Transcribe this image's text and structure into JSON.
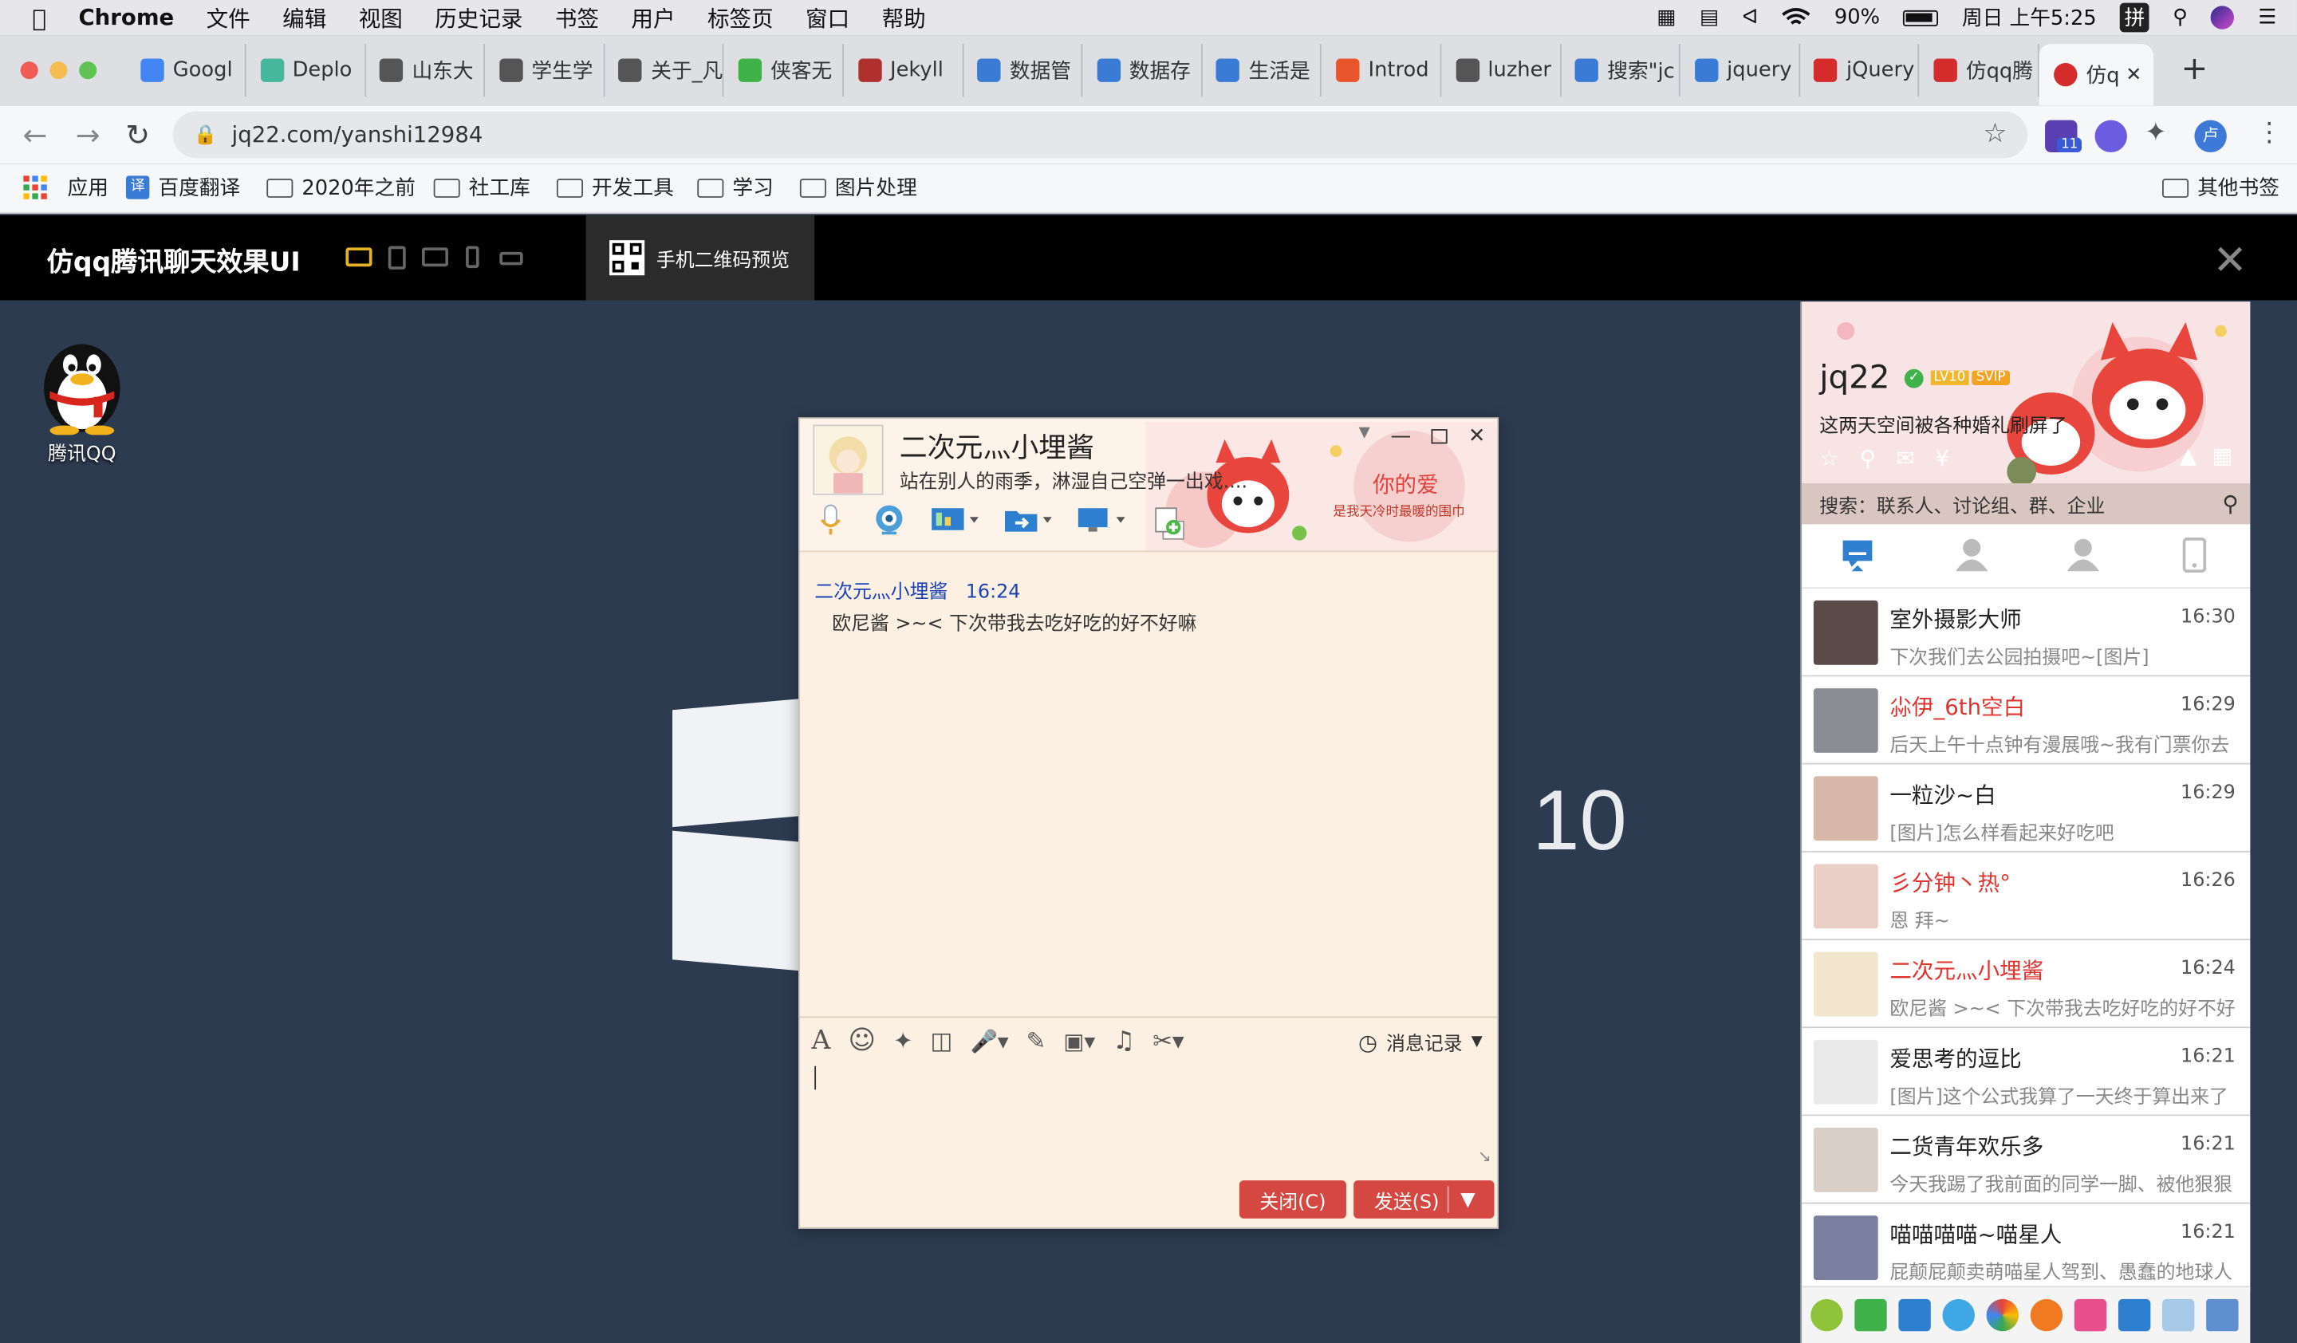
{
  "menubar": {
    "app": "Chrome",
    "items": [
      "文件",
      "编辑",
      "视图",
      "历史记录",
      "书签",
      "用户",
      "标签页",
      "窗口",
      "帮助"
    ],
    "battery": "90%",
    "clock": "周日 上午5:25",
    "ime": "拼"
  },
  "tabs": [
    {
      "label": "Googl",
      "color": "#4285f4"
    },
    {
      "label": "Deplo",
      "color": "#44b79c"
    },
    {
      "label": "山东大",
      "color": "#555"
    },
    {
      "label": "学生学",
      "color": "#555"
    },
    {
      "label": "关于_凡",
      "color": "#555"
    },
    {
      "label": "侠客无",
      "color": "#3fb24a"
    },
    {
      "label": "Jekyll",
      "color": "#b03030"
    },
    {
      "label": "数据管",
      "color": "#3a7bd5"
    },
    {
      "label": "数据存",
      "color": "#3a7bd5"
    },
    {
      "label": "生活是",
      "color": "#3a7bd5"
    },
    {
      "label": "Introd",
      "color": "#e8552a"
    },
    {
      "label": "luzher",
      "color": "#555"
    },
    {
      "label": "搜索\"jc",
      "color": "#3a7bd5"
    },
    {
      "label": "jquery",
      "color": "#3a7bd5"
    },
    {
      "label": "jQuery",
      "color": "#d42b2b"
    },
    {
      "label": "仿qq腾",
      "color": "#d42b2b"
    }
  ],
  "active_tab": {
    "label": "仿q",
    "close": "✕"
  },
  "address": {
    "url": "jq22.com/yanshi12984"
  },
  "extensions": {
    "badge": "11",
    "avatar": "卢"
  },
  "bookmarks": {
    "apps": "应用",
    "items": [
      "百度翻译",
      "2020年之前",
      "社工库",
      "开发工具",
      "学习",
      "图片处理"
    ],
    "other": "其他书签"
  },
  "page_header": {
    "title": "仿qq腾讯聊天效果UI",
    "qr_label": "手机二维码预览",
    "close": "✕"
  },
  "desktop": {
    "qq_label": "腾讯QQ",
    "win_text": "10"
  },
  "chat": {
    "name": "二次元灬小埋酱",
    "signature": "站在别人的雨季，淋湿自己空弹一出戏....",
    "banner_text": "你的爱",
    "banner_sub": "是我天冷时最暖的围巾",
    "message": {
      "sender": "二次元灬小埋酱",
      "time": "16:24",
      "text": "欧尼酱 >~< 下次带我去吃好吃的好不好嘛"
    },
    "history_label": "消息记录",
    "close_button": "关闭(C)",
    "send_button": "发送(S)"
  },
  "panel": {
    "username": "jq22",
    "level": "LV10",
    "svip": "SVIP",
    "signature": "这两天空间被各种婚礼刷屏了",
    "search_placeholder": "搜索：联系人、讨论组、群、企业",
    "contacts": [
      {
        "name": "室外摄影大师",
        "time": "16:30",
        "preview": "下次我们去公园拍摄吧~[图片]",
        "red": false,
        "color": "#5b4a4a"
      },
      {
        "name": "尛伊_6th空白",
        "time": "16:29",
        "preview": "后天上午十点钟有漫展哦~我有门票你去",
        "red": true,
        "color": "#8c8c94"
      },
      {
        "name": "一粒沙~白",
        "time": "16:29",
        "preview": "[图片]怎么样看起来好吃吧",
        "red": false,
        "color": "#d8b8a8"
      },
      {
        "name": "彡分钟丶热°",
        "time": "16:26",
        "preview": "恩 拜~",
        "red": true,
        "color": "#e9cfc6"
      },
      {
        "name": "二次元灬小埋酱",
        "time": "16:24",
        "preview": "欧尼酱 >~< 下次带我去吃好吃的好不好",
        "red": true,
        "color": "#f3e6cf"
      },
      {
        "name": "爱思考的逗比",
        "time": "16:21",
        "preview": "[图片]这个公式我算了一天终于算出来了",
        "red": false,
        "color": "#e9e9e9"
      },
      {
        "name": "二货青年欢乐多",
        "time": "16:21",
        "preview": "今天我踢了我前面的同学一脚、被他狠狠",
        "red": false,
        "color": "#d9cfc6"
      },
      {
        "name": "喵喵喵喵~喵星人",
        "time": "16:21",
        "preview": "屁颠屁颠卖萌喵星人驾到、愚蠢的地球人",
        "red": false,
        "color": "#7a7fa0"
      }
    ]
  }
}
